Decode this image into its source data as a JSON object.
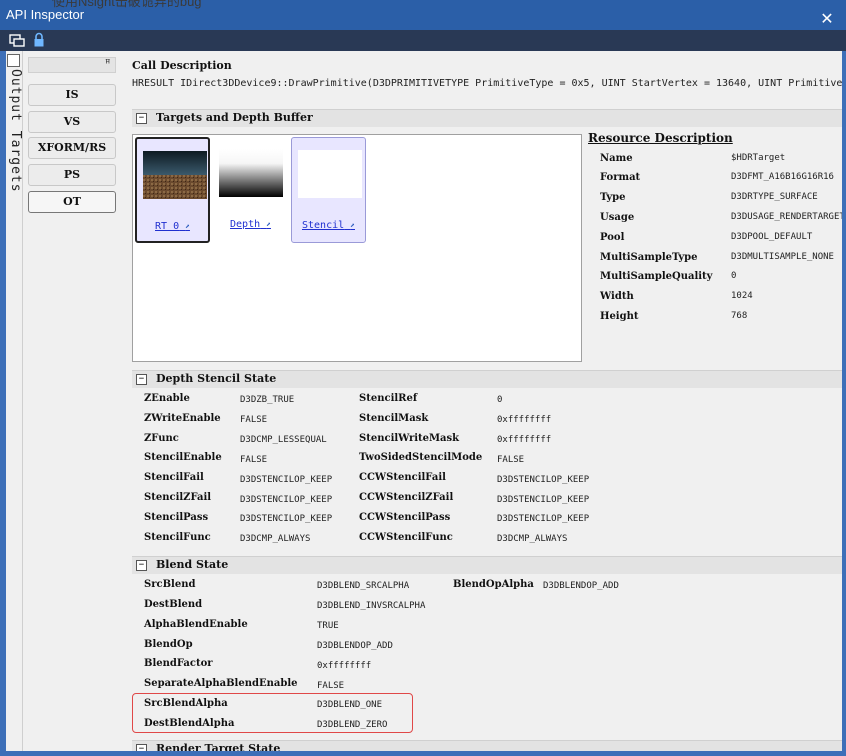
{
  "background_text": "使用Nsight击破诡异的bug",
  "window": {
    "title": "API Inspector",
    "close_icon": "close-icon"
  },
  "toolbar": {
    "icons": [
      "window-layout-icon",
      "lock-icon"
    ]
  },
  "vertical_tab": {
    "label": "Output Targets",
    "icon": "panel-icon"
  },
  "sidebar": {
    "buttons": [
      {
        "label": "IS"
      },
      {
        "label": "VS"
      },
      {
        "label": "XFORM/RS"
      },
      {
        "label": "PS"
      },
      {
        "label": "OT",
        "active": true
      }
    ]
  },
  "call": {
    "heading": "Call Description",
    "text": "HRESULT IDirect3DDevice9::DrawPrimitive(D3DPRIMITIVETYPE PrimitiveType = 0x5, UINT StartVertex = 13640, UINT PrimitiveC"
  },
  "targets": {
    "section_title": "Targets and Depth Buffer",
    "cards": [
      {
        "label": "RT 0",
        "thumb": "terrain"
      },
      {
        "label": "Depth",
        "thumb": "gradient"
      },
      {
        "label": "Stencil",
        "thumb": "white"
      }
    ]
  },
  "resource": {
    "heading": "Resource Description",
    "rows": [
      {
        "k": "Name",
        "v": "$HDRTarget"
      },
      {
        "k": "Format",
        "v": "D3DFMT_A16B16G16R16"
      },
      {
        "k": "Type",
        "v": "D3DRTYPE_SURFACE"
      },
      {
        "k": "Usage",
        "v": "D3DUSAGE_RENDERTARGET"
      },
      {
        "k": "Pool",
        "v": "D3DPOOL_DEFAULT"
      },
      {
        "k": "MultiSampleType",
        "v": "D3DMULTISAMPLE_NONE"
      },
      {
        "k": "MultiSampleQuality",
        "v": "0"
      },
      {
        "k": "Width",
        "v": "1024"
      },
      {
        "k": "Height",
        "v": "768"
      }
    ]
  },
  "depth_stencil": {
    "section_title": "Depth Stencil State",
    "left": [
      {
        "k": "ZEnable",
        "v": "D3DZB_TRUE"
      },
      {
        "k": "ZWriteEnable",
        "v": "FALSE"
      },
      {
        "k": "ZFunc",
        "v": "D3DCMP_LESSEQUAL"
      },
      {
        "k": "StencilEnable",
        "v": "FALSE"
      },
      {
        "k": "StencilFail",
        "v": "D3DSTENCILOP_KEEP"
      },
      {
        "k": "StencilZFail",
        "v": "D3DSTENCILOP_KEEP"
      },
      {
        "k": "StencilPass",
        "v": "D3DSTENCILOP_KEEP"
      },
      {
        "k": "StencilFunc",
        "v": "D3DCMP_ALWAYS"
      }
    ],
    "right": [
      {
        "k": "StencilRef",
        "v": "0"
      },
      {
        "k": "StencilMask",
        "v": "0xffffffff"
      },
      {
        "k": "StencilWriteMask",
        "v": "0xffffffff"
      },
      {
        "k": "TwoSidedStencilMode",
        "v": "FALSE"
      },
      {
        "k": "CCWStencilFail",
        "v": "D3DSTENCILOP_KEEP"
      },
      {
        "k": "CCWStencilZFail",
        "v": "D3DSTENCILOP_KEEP"
      },
      {
        "k": "CCWStencilPass",
        "v": "D3DSTENCILOP_KEEP"
      },
      {
        "k": "CCWStencilFunc",
        "v": "D3DCMP_ALWAYS"
      }
    ]
  },
  "blend": {
    "section_title": "Blend State",
    "left": [
      {
        "k": "SrcBlend",
        "v": "D3DBLEND_SRCALPHA"
      },
      {
        "k": "DestBlend",
        "v": "D3DBLEND_INVSRCALPHA"
      },
      {
        "k": "AlphaBlendEnable",
        "v": "TRUE"
      },
      {
        "k": "BlendOp",
        "v": "D3DBLENDOP_ADD"
      },
      {
        "k": "BlendFactor",
        "v": "0xffffffff"
      },
      {
        "k": "SeparateAlphaBlendEnable",
        "v": "FALSE"
      },
      {
        "k": "SrcBlendAlpha",
        "v": "D3DBLEND_ONE"
      },
      {
        "k": "DestBlendAlpha",
        "v": "D3DBLEND_ZERO"
      }
    ],
    "right": [
      {
        "k": "BlendOpAlpha",
        "v": "D3DBLENDOP_ADD"
      }
    ]
  },
  "render_target_state": {
    "section_title": "Render Target State"
  },
  "colors": {
    "titlebar": "#2b5fa8",
    "toolbar": "#293955",
    "highlight_box": "#e04848",
    "link": "#2030d0"
  }
}
